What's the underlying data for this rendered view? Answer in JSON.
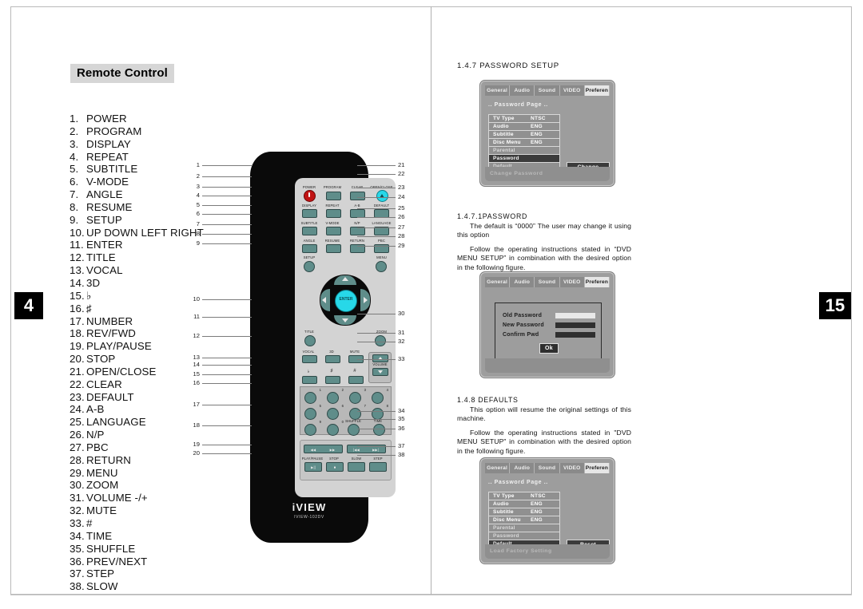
{
  "page": {
    "left_page_number": "4",
    "right_page_number": "15"
  },
  "left": {
    "section_title": "Remote Control",
    "buttons": [
      {
        "num": "1.",
        "label": "POWER"
      },
      {
        "num": "2.",
        "label": "PROGRAM"
      },
      {
        "num": "3.",
        "label": "DISPLAY"
      },
      {
        "num": "4.",
        "label": "REPEAT"
      },
      {
        "num": "5.",
        "label": "SUBTITLE"
      },
      {
        "num": "6.",
        "label": "V-MODE"
      },
      {
        "num": "7.",
        "label": "ANGLE"
      },
      {
        "num": "8.",
        "label": "RESUME"
      },
      {
        "num": "9.",
        "label": "SETUP"
      },
      {
        "num": "10.",
        "label": "UP DOWN LEFT RIGHT"
      },
      {
        "num": "11.",
        "label": "ENTER"
      },
      {
        "num": "12.",
        "label": "TITLE"
      },
      {
        "num": "13.",
        "label": "VOCAL"
      },
      {
        "num": "14.",
        "label": "3D"
      },
      {
        "num": "15.",
        "label": "♭"
      },
      {
        "num": "16.",
        "label": "♯"
      },
      {
        "num": "17.",
        "label": "NUMBER"
      },
      {
        "num": "18.",
        "label": "REV/FWD"
      },
      {
        "num": "19.",
        "label": "PLAY/PAUSE"
      },
      {
        "num": "20.",
        "label": "STOP"
      },
      {
        "num": "21.",
        "label": "OPEN/CLOSE"
      },
      {
        "num": "22.",
        "label": "CLEAR"
      },
      {
        "num": "23.",
        "label": "DEFAULT"
      },
      {
        "num": "24.",
        "label": "A-B"
      },
      {
        "num": "25.",
        "label": "LANGUAGE"
      },
      {
        "num": "26.",
        "label": "N/P"
      },
      {
        "num": "27.",
        "label": "PBC"
      },
      {
        "num": "28.",
        "label": "RETURN"
      },
      {
        "num": "29.",
        "label": "MENU"
      },
      {
        "num": "30.",
        "label": "ZOOM"
      },
      {
        "num": "31.",
        "label": "VOLUME -/+"
      },
      {
        "num": "32.",
        "label": "MUTE"
      },
      {
        "num": "33.",
        "label": "#"
      },
      {
        "num": "34.",
        "label": "TIME"
      },
      {
        "num": "35.",
        "label": "SHUFFLE"
      },
      {
        "num": "36.",
        "label": "PREV/NEXT"
      },
      {
        "num": "37.",
        "label": "STEP"
      },
      {
        "num": "38.",
        "label": "SLOW"
      }
    ],
    "remote": {
      "brand": "iVIEW",
      "model": "IVIEW-102DV",
      "keys": {
        "power": "POWER",
        "program": "PROGRAM",
        "clear": "CLEAR",
        "open_close": "OPEN/CLOSE",
        "display": "DISPLAY",
        "repeat": "REPEAT",
        "ab": "A-B",
        "default": "DEFAULT",
        "subtitle": "SUBTITLE",
        "vmode": "V-MODE",
        "np": "N/P",
        "language": "LANGUAGE",
        "angle": "ANGLE",
        "resume": "RESUME",
        "return": "RETURN",
        "pbc": "PBC",
        "setup": "SETUP",
        "menu": "MENU",
        "enter": "ENTER",
        "title": "TITLE",
        "zoom": "ZOOM",
        "vocal": "VOCAL",
        "three_d": "3D",
        "mute": "MUTE",
        "volume": "VOLUME",
        "flat": "♭",
        "sharp": "♯",
        "hash": "#",
        "shuffle": "SHUFFLE",
        "time": "TIME",
        "play_pause": "PLAY/PAUSE",
        "stop": "STOP",
        "slow": "SLOW",
        "step": "STEP",
        "n0": "0",
        "n1": "1",
        "n2": "2",
        "n3": "3",
        "n4": "4",
        "n5": "5",
        "n6": "6",
        "n7": "7",
        "n8": "8",
        "n9": "9"
      }
    },
    "callouts_left": [
      "1",
      "2",
      "3",
      "4",
      "5",
      "6",
      "7",
      "8",
      "9",
      "10",
      "11",
      "12",
      "13",
      "14",
      "15",
      "16",
      "17",
      "18",
      "19",
      "20"
    ],
    "callouts_right": [
      "21",
      "22",
      "23",
      "24",
      "25",
      "26",
      "27",
      "28",
      "29",
      "30",
      "31",
      "32",
      "33",
      "34",
      "35",
      "36",
      "37",
      "38"
    ]
  },
  "right": {
    "s1": {
      "heading": "1.4.7 PASSWORD SETUP"
    },
    "s1_1": {
      "heading": "1.4.7.1PASSWORD",
      "p1": "The default is “0000” The user may change  it using this option",
      "p2": "Follow the operating instructions stated in “DVD MENU SETUP” in combination with the desired option in the following figure."
    },
    "s2": {
      "heading": "1.4.8 DEFAULTS",
      "p1": "This option will resume the original settings of this machine.",
      "p2": "Follow the operating instructions stated in \"DVD MENU SETUP\" in combination with the desired option in the following figure."
    },
    "osd_tabs": [
      "General",
      "Audio",
      "Sound",
      "VIDEO",
      "Preferen"
    ],
    "osd_password": {
      "page_title": ".. Password Page ..",
      "rows": [
        {
          "label": "TV Type",
          "value": "NTSC"
        },
        {
          "label": "Audio",
          "value": "ENG"
        },
        {
          "label": "Subtitle",
          "value": "ENG"
        },
        {
          "label": "Disc Menu",
          "value": "ENG"
        },
        {
          "label": "Parental",
          "value": ""
        },
        {
          "label": "Password",
          "value": ""
        },
        {
          "label": "Default",
          "value": ""
        }
      ],
      "selected_row": "Password",
      "action": "Change",
      "footer": "Change Password"
    },
    "osd_dialog": {
      "fields": [
        "Old  Password",
        "New Password",
        "Confirm Pwd"
      ],
      "ok": "Ok"
    },
    "osd_defaults": {
      "page_title": ".. Password Page ..",
      "rows": [
        {
          "label": "TV Type",
          "value": "NTSC"
        },
        {
          "label": "Audio",
          "value": "ENG"
        },
        {
          "label": "Subtitle",
          "value": "ENG"
        },
        {
          "label": "Disc Menu",
          "value": "ENG"
        },
        {
          "label": "Parental",
          "value": ""
        },
        {
          "label": "Password",
          "value": ""
        },
        {
          "label": "Default",
          "value": ""
        }
      ],
      "selected_row": "Default",
      "action": "Reset",
      "footer": "Load Factory Setting"
    }
  }
}
